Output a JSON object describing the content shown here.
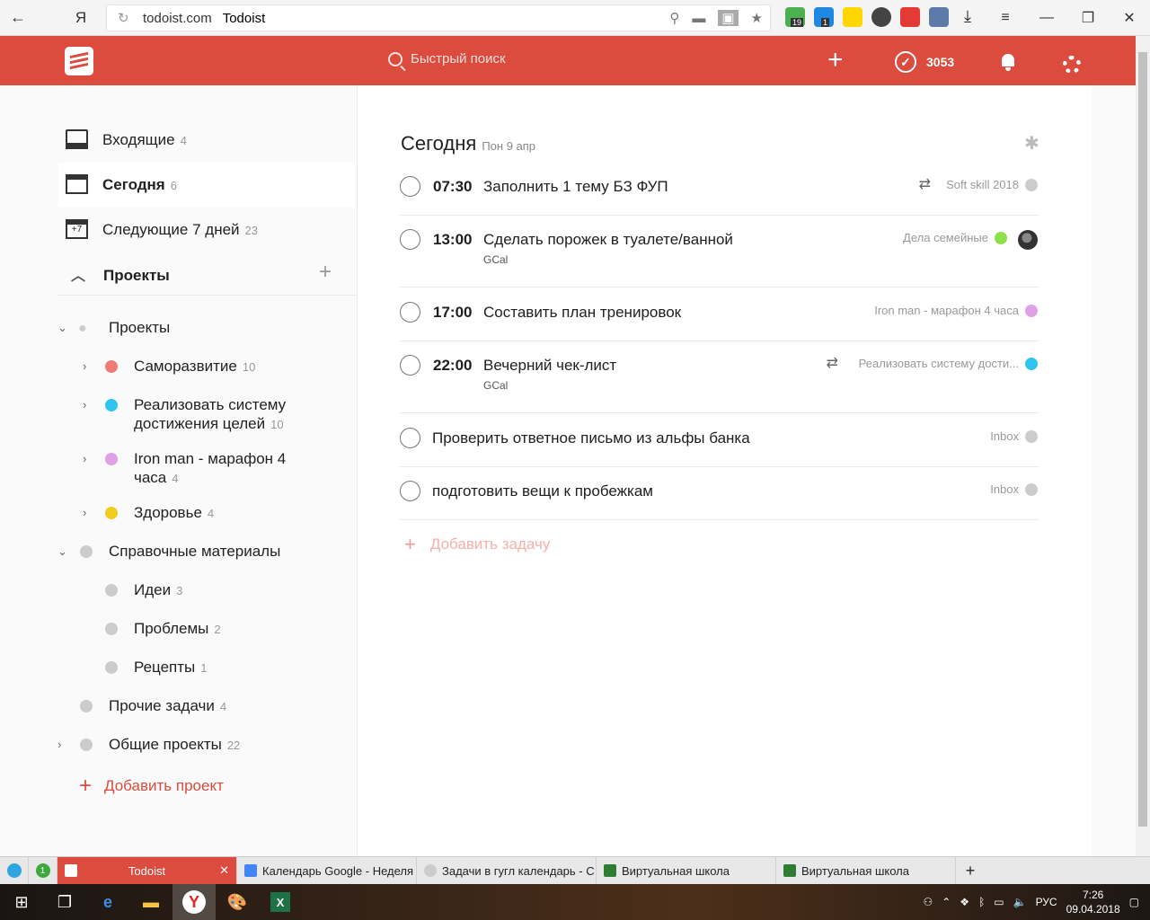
{
  "browser": {
    "domain": "todoist.com",
    "page_title": "Todoist",
    "back_icon": "←",
    "yandex_label": "Я",
    "ext_badges": [
      "19",
      "1"
    ]
  },
  "topbar": {
    "search_placeholder": "Быстрый поиск",
    "karma": "3053",
    "brand_color": "#db4c3f"
  },
  "sidebar": {
    "nav": [
      {
        "label": "Входящие",
        "count": "4"
      },
      {
        "label": "Сегодня",
        "count": "6"
      },
      {
        "label": "Следующие 7 дней",
        "count": "23"
      }
    ],
    "projects_header": "Проекты",
    "add_project": "Добавить проект",
    "projects": [
      {
        "name": "Проекты",
        "count": ""
      },
      {
        "name": "Саморазвитие",
        "count": "10",
        "color": "#f07b73"
      },
      {
        "name_l1": "Реализовать систему",
        "name_l2": "достижения целей",
        "count": "10",
        "color": "#2fc4f0"
      },
      {
        "name_l1": "Iron man - марафон 4",
        "name_l2": "часа",
        "count": "4",
        "color": "#e0a0e6"
      },
      {
        "name": "Здоровье",
        "count": "4",
        "color": "#f2cc1a"
      },
      {
        "name": "Справочные материалы",
        "count": ""
      },
      {
        "name": "Идеи",
        "count": "3"
      },
      {
        "name": "Проблемы",
        "count": "2"
      },
      {
        "name": "Рецепты",
        "count": "1"
      },
      {
        "name": "Прочие задачи",
        "count": "4"
      },
      {
        "name": "Общие проекты",
        "count": "22"
      }
    ]
  },
  "main": {
    "title": "Сегодня",
    "date": "Пон 9 апр",
    "add_task": "Добавить задачу",
    "tasks": [
      {
        "time": "07:30",
        "text": "Заполнить 1 тему БЗ ФУП",
        "project": "Soft skill 2018",
        "dot": "#cccccc"
      },
      {
        "time": "13:00",
        "text": "Сделать порожек в туалете/ванной",
        "sub": "GCal",
        "project": "Дела семейные",
        "dot": "#8ee04a"
      },
      {
        "time": "17:00",
        "text": "Составить план тренировок",
        "project": "Iron man - марафон 4 часа",
        "dot": "#e0a0e6"
      },
      {
        "time": "22:00",
        "text": "Вечерний чек-лист",
        "sub": "GCal",
        "project": "Реализовать систему дости...",
        "dot": "#2fc4f0"
      },
      {
        "text": "Проверить ответное письмо из альфы банка",
        "project": "Inbox",
        "dot": "#cccccc"
      },
      {
        "text": "подготовить вещи к пробежкам",
        "project": "Inbox",
        "dot": "#cccccc"
      }
    ]
  },
  "browser_tabs": [
    {
      "label": "Todoist"
    },
    {
      "label": "Календарь Google - Неделя"
    },
    {
      "label": "Задачи в гугл календарь - С"
    },
    {
      "label": "Виртуальная школа"
    },
    {
      "label": "Виртуальная школа"
    }
  ],
  "tray": {
    "lang": "РУС",
    "time": "7:26",
    "date": "09.04.2018",
    "tab_badge": "1"
  }
}
